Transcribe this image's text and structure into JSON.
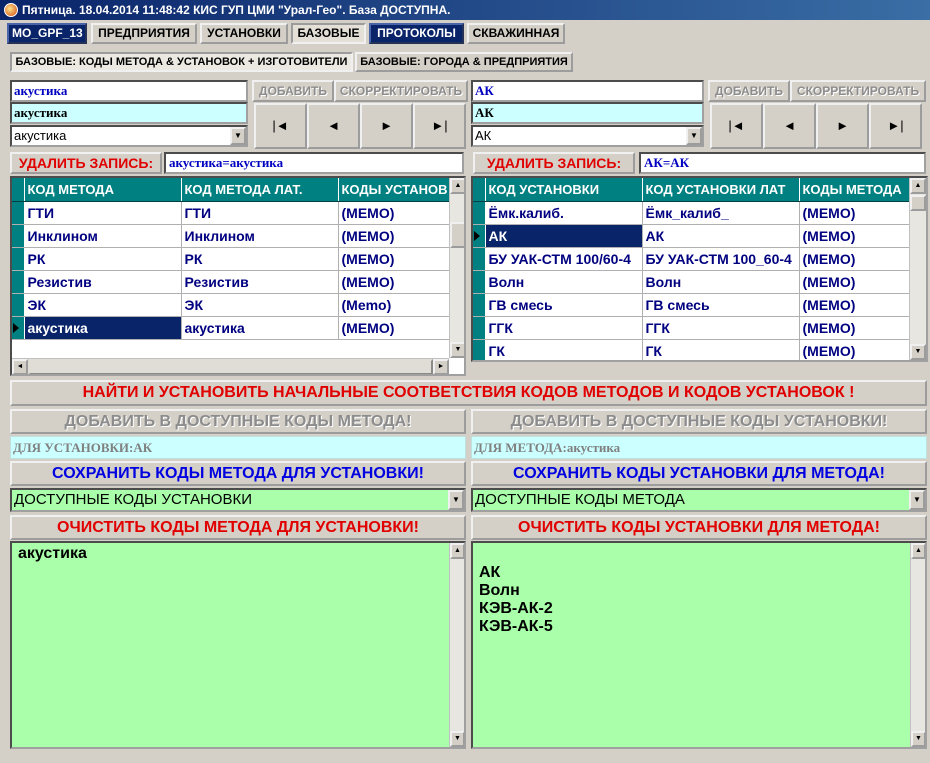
{
  "window": {
    "title": "Пятница. 18.04.2014 11:48:42  КИС ГУП ЦМИ \"Урал-Гео\". База ДОСТУПНА."
  },
  "tabs": [
    "MO_GPF_13",
    "ПРЕДПРИЯТИЯ",
    "УСТАНОВКИ",
    "БАЗОВЫЕ",
    "ПРОТОКОЛЫ",
    "СКВАЖИННАЯ"
  ],
  "subtabs": [
    "БАЗОВЫЕ: КОДЫ МЕТОДА & УСТАНОВОК + ИЗГОТОВИТЕЛИ",
    "БАЗОВЫЕ: ГОРОДА & ПРЕДПРИЯТИЯ"
  ],
  "left": {
    "field1": "акустика",
    "field2": "акустика",
    "combo": "акустика",
    "add_label": "ДОБАВИТЬ",
    "edit_label": "СКОРРЕКТИРОВАТЬ",
    "nav": [
      "|◄",
      "◄",
      "►",
      "►|"
    ],
    "delete_label": "УДАЛИТЬ ЗАПИСЬ:",
    "delete_value": "акустика=акустика",
    "columns": [
      "КОД МЕТОДА",
      "КОД МЕТОДА ЛАТ.",
      "КОДЫ УСТАНОВ"
    ],
    "rows": [
      [
        "ГТИ",
        "ГТИ",
        "(МЕМО)"
      ],
      [
        "Инклином",
        "Инклином",
        "(МЕМО)"
      ],
      [
        "РК",
        "РК",
        "(МЕМО)"
      ],
      [
        "Резистив",
        "Резистив",
        "(МЕМО)"
      ],
      [
        "ЭК",
        "ЭК",
        "(Memo)"
      ],
      [
        "акустика",
        "акустика",
        "(МЕМО)"
      ]
    ],
    "current_row": 5
  },
  "right": {
    "field1": "АК",
    "field2": "АК",
    "combo": "АК",
    "add_label": "ДОБАВИТЬ",
    "edit_label": "СКОРРЕКТИРОВАТЬ",
    "nav": [
      "|◄",
      "◄",
      "►",
      "►|"
    ],
    "delete_label": "УДАЛИТЬ ЗАПИСЬ:",
    "delete_value": "АК=АК",
    "columns": [
      "КОД УСТАНОВКИ",
      "КОД УСТАНОВКИ ЛАТ",
      "КОДЫ МЕТОДА"
    ],
    "rows": [
      [
        "Ёмк.калиб.",
        "Ёмк_калиб_",
        "(МЕМО)"
      ],
      [
        "АК",
        "АК",
        "(МЕМО)"
      ],
      [
        "БУ УАК-СТМ 100/60-4",
        "БУ УАК-СТМ 100_60-4",
        "(МЕМО)"
      ],
      [
        "Волн",
        "Волн",
        "(МЕМО)"
      ],
      [
        "ГВ смесь",
        "ГВ смесь",
        "(МЕМО)"
      ],
      [
        "ГГК",
        "ГГК",
        "(МЕМО)"
      ],
      [
        "ГК",
        "ГК",
        "(МЕМО)"
      ]
    ],
    "current_row": 1
  },
  "find_button": "НАЙТИ И УСТАНОВИТЬ НАЧАЛЬНЫЕ СООТВЕТСТВИЯ КОДОВ МЕТОДОВ И КОДОВ УСТАНОВОК !",
  "bottom_left": {
    "add_button": "ДОБАВИТЬ В ДОСТУПНЫЕ КОДЫ МЕТОДА!",
    "for_field": "ДЛЯ УСТАНОВКИ:АК",
    "save_button": "СОХРАНИТЬ КОДЫ МЕТОДА ДЛЯ УСТАНОВКИ!",
    "combo": "ДОСТУПНЫЕ КОДЫ УСТАНОВКИ",
    "clear_button": "ОЧИСТИТЬ КОДЫ МЕТОДА ДЛЯ УСТАНОВКИ!",
    "memo_lines": [
      "акустика"
    ]
  },
  "bottom_right": {
    "add_button": "ДОБАВИТЬ В ДОСТУПНЫЕ КОДЫ УСТАНОВКИ!",
    "for_field": "ДЛЯ МЕТОДА:акустика",
    "save_button": "СОХРАНИТЬ КОДЫ УСТАНОВКИ ДЛЯ МЕТОДА!",
    "combo": "ДОСТУПНЫЕ КОДЫ МЕТОДА",
    "clear_button": "ОЧИСТИТЬ КОДЫ УСТАНОВКИ ДЛЯ МЕТОДА!",
    "memo_lines": [
      "",
      "АК",
      "Волн",
      "КЭВ-АК-2",
      "КЭВ-АК-5"
    ]
  },
  "icons": {
    "app": "app-icon",
    "dropdown": "dropdown-arrow-icon",
    "scroll_up": "scroll-up-icon",
    "scroll_down": "scroll-down-icon",
    "scroll_left": "scroll-left-icon",
    "scroll_right": "scroll-right-icon"
  },
  "colors": {
    "header_teal": "#008080",
    "cyan_field": "#ccffff",
    "memo_green": "#aaffaa",
    "alert_red": "#e00000",
    "save_blue": "#0000e0",
    "title_navy": "#0a246a"
  }
}
